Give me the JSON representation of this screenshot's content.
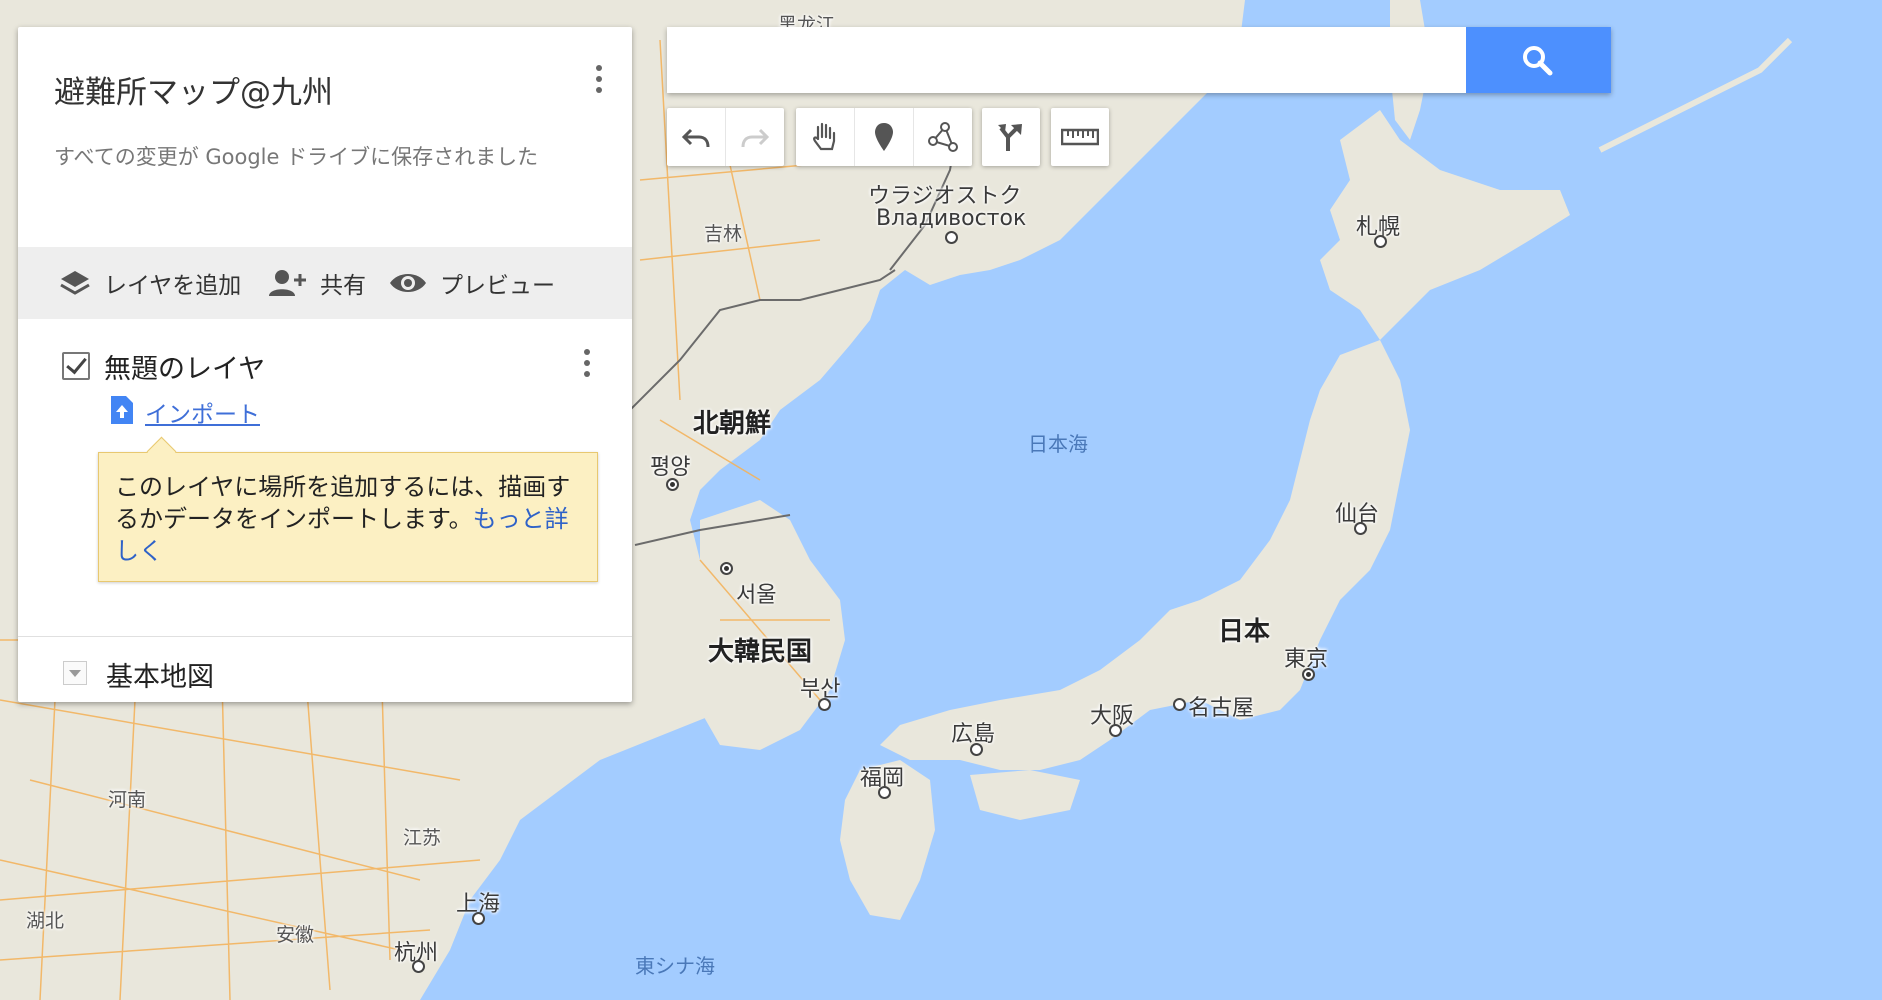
{
  "map": {
    "colors": {
      "sea": "#a3ccff",
      "land": "#e8e7de",
      "road": "#f5b55a",
      "border": "#666666"
    },
    "labels": {
      "heilongjiang": "黑龙江",
      "vladivostok_jp": "ウラジオストク",
      "vladivostok_ru": "Владивосток",
      "jilin": "吉林",
      "sapporo": "札幌",
      "north_korea": "北朝鮮",
      "sea_of_japan": "日本海",
      "pyongyang": "평양",
      "sendai": "仙台",
      "seoul": "서울",
      "japan": "日本",
      "south_korea": "大韓民国",
      "tokyo": "東京",
      "busan": "부산",
      "osaka": "大阪",
      "nagoya": "名古屋",
      "hiroshima": "広島",
      "fukuoka": "福岡",
      "henan": "河南",
      "jiangsu": "江苏",
      "shanghai": "上海",
      "hubei": "湖北",
      "anhui": "安徽",
      "hangzhou": "杭州",
      "east_china_sea": "東シナ海"
    }
  },
  "panel": {
    "title": "避難所マップ@九州",
    "saved_status": "すべての変更が Google ドライブに保存されました",
    "actions": {
      "add_layer": "レイヤを追加",
      "share": "共有",
      "preview": "プレビュー"
    },
    "layer": {
      "name": "無題のレイヤ",
      "checked": true,
      "import_label": "インポート",
      "tip_text": "このレイヤに場所を追加するには、描画するかデータをインポートします。",
      "tip_link": "もっと詳しく"
    },
    "base_map_label": "基本地図"
  },
  "search": {
    "value": "",
    "icon": "search-icon"
  },
  "toolbar": {
    "icons": [
      "undo-icon",
      "redo-icon",
      "hand-icon",
      "marker-icon",
      "line-icon",
      "directions-icon",
      "ruler-icon"
    ]
  }
}
